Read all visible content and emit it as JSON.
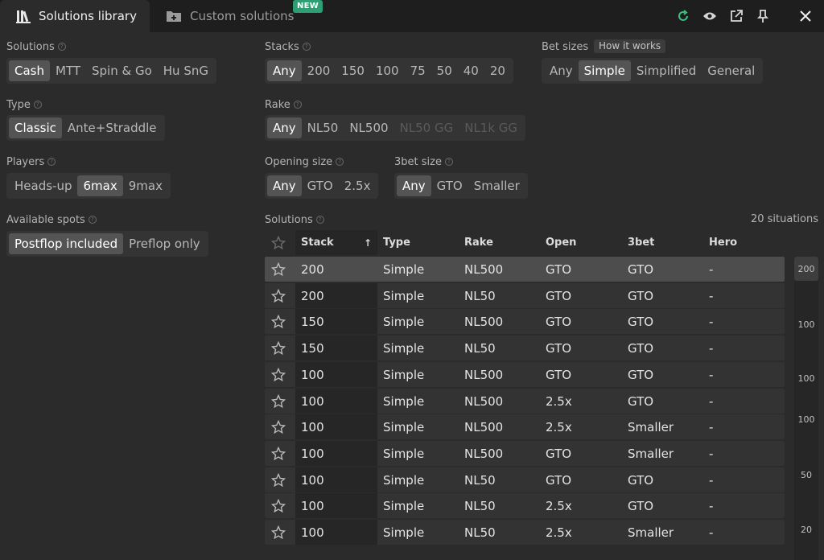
{
  "tabs": [
    {
      "label": "Solutions library",
      "icon": "library-icon",
      "active": true
    },
    {
      "label": "Custom solutions",
      "icon": "folder-plus-icon",
      "active": false,
      "badge": "NEW"
    }
  ],
  "window_icons": [
    "refresh-icon",
    "eye-icon",
    "external-link-icon",
    "pin-icon",
    "close-icon"
  ],
  "filters": {
    "solutions": {
      "label": "Solutions",
      "options": [
        "Cash",
        "MTT",
        "Spin & Go",
        "Hu SnG"
      ],
      "selected": "Cash"
    },
    "type": {
      "label": "Type",
      "options": [
        "Classic",
        "Ante+Straddle"
      ],
      "selected": "Classic"
    },
    "players": {
      "label": "Players",
      "options": [
        "Heads-up",
        "6max",
        "9max"
      ],
      "selected": "6max"
    },
    "available_spots": {
      "label": "Available spots",
      "options": [
        "Postflop included",
        "Preflop only"
      ],
      "selected": "Postflop included"
    },
    "stacks": {
      "label": "Stacks",
      "options": [
        "Any",
        "200",
        "150",
        "100",
        "75",
        "50",
        "40",
        "20"
      ],
      "selected": "Any"
    },
    "rake": {
      "label": "Rake",
      "options": [
        "Any",
        "NL50",
        "NL500",
        "NL50 GG",
        "NL1k GG"
      ],
      "selected": "Any",
      "disabled": [
        "NL50 GG",
        "NL1k GG"
      ]
    },
    "opening_size": {
      "label": "Opening size",
      "options": [
        "Any",
        "GTO",
        "2.5x"
      ],
      "selected": "Any"
    },
    "threebet_size": {
      "label": "3bet size",
      "options": [
        "Any",
        "GTO",
        "Smaller"
      ],
      "selected": "Any"
    },
    "bet_sizes": {
      "label": "Bet sizes",
      "how_it_works": "How it works",
      "options": [
        "Any",
        "Simple",
        "Simplified",
        "General"
      ],
      "selected": "Simple"
    }
  },
  "solutions_table": {
    "label": "Solutions",
    "count": "20 situations",
    "columns": [
      "Stack",
      "Type",
      "Rake",
      "Open",
      "3bet",
      "Hero"
    ],
    "sort_indicator": "↑",
    "rows": [
      [
        "200",
        "Simple",
        "NL500",
        "GTO",
        "GTO",
        "-"
      ],
      [
        "200",
        "Simple",
        "NL50",
        "GTO",
        "GTO",
        "-"
      ],
      [
        "150",
        "Simple",
        "NL500",
        "GTO",
        "GTO",
        "-"
      ],
      [
        "150",
        "Simple",
        "NL50",
        "GTO",
        "GTO",
        "-"
      ],
      [
        "100",
        "Simple",
        "NL500",
        "GTO",
        "GTO",
        "-"
      ],
      [
        "100",
        "Simple",
        "NL500",
        "2.5x",
        "GTO",
        "-"
      ],
      [
        "100",
        "Simple",
        "NL500",
        "2.5x",
        "Smaller",
        "-"
      ],
      [
        "100",
        "Simple",
        "NL500",
        "GTO",
        "Smaller",
        "-"
      ],
      [
        "100",
        "Simple",
        "NL50",
        "GTO",
        "GTO",
        "-"
      ],
      [
        "100",
        "Simple",
        "NL50",
        "2.5x",
        "GTO",
        "-"
      ],
      [
        "100",
        "Simple",
        "NL50",
        "2.5x",
        "Smaller",
        "-"
      ]
    ],
    "selected_row": 0
  },
  "scroll_markers": [
    "200",
    "100",
    "100",
    "100",
    "50",
    "20"
  ],
  "colors": {
    "accent_green": "#2e9e74",
    "refresh_green": "#3fbf7f",
    "selected_bg": "#545454"
  }
}
